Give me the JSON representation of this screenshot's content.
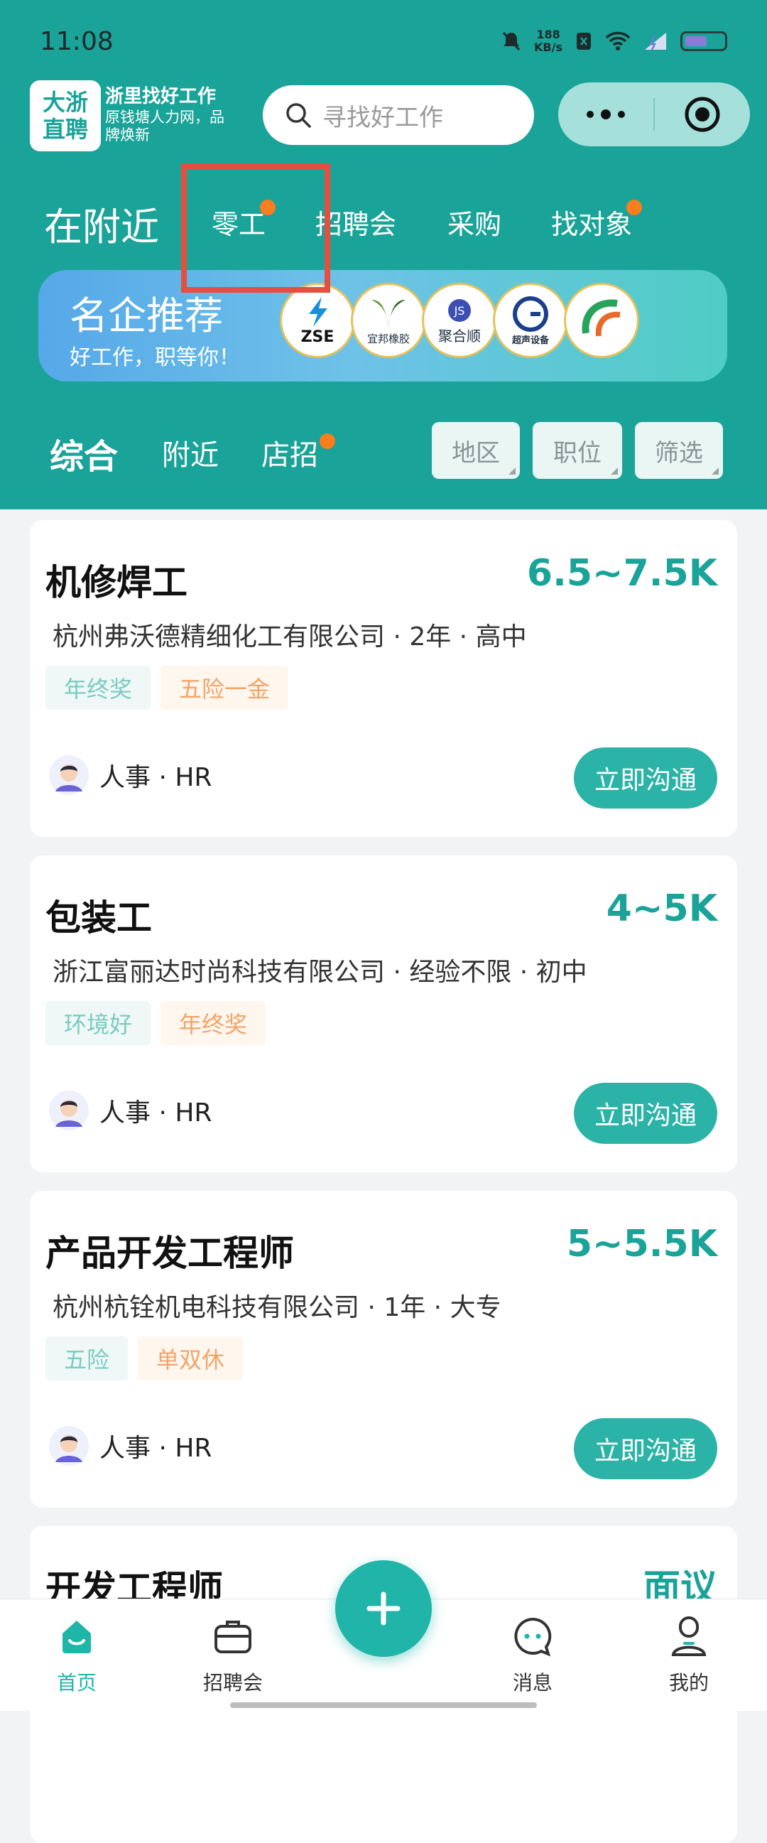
{
  "status": {
    "time": "11:08",
    "speed_value": "188",
    "speed_unit": "KB/s"
  },
  "header": {
    "logo_line1": "大浙",
    "logo_line2": "直聘",
    "logo_title": "浙里找好工作",
    "logo_sub": "原钱塘人力网，品牌焕新",
    "search_placeholder": "寻找好工作"
  },
  "nav": {
    "near": "在附近",
    "items": [
      {
        "label": "零工",
        "dot": true
      },
      {
        "label": "招聘会",
        "dot": false
      },
      {
        "label": "采购",
        "dot": false
      },
      {
        "label": "找对象",
        "dot": true
      }
    ]
  },
  "banner": {
    "title": "名企推荐",
    "subtitle": "好工作，职等你！",
    "brands": [
      "ZSE",
      "宜邦橡胶",
      "聚合顺",
      "超声设备",
      ""
    ]
  },
  "tabs": {
    "active": "综合",
    "near": "附近",
    "shop": "店招",
    "filters": [
      "地区",
      "职位",
      "筛选"
    ]
  },
  "jobs": [
    {
      "title": "机修焊工",
      "salary": "6.5~7.5K",
      "company": "杭州弗沃德精细化工有限公司 · 2年 · 高中",
      "tags": [
        "年终奖",
        "五险一金"
      ],
      "hr": "人事 · HR",
      "action": "立即沟通"
    },
    {
      "title": "包装工",
      "salary": "4~5K",
      "company": "浙江富丽达时尚科技有限公司 · 经验不限 · 初中",
      "tags": [
        "环境好",
        "年终奖"
      ],
      "hr": "人事 · HR",
      "action": "立即沟通"
    },
    {
      "title": "产品开发工程师",
      "salary": "5~5.5K",
      "company": "杭州杭铨机电科技有限公司 · 1年 · 大专",
      "tags": [
        "五险",
        "单双休"
      ],
      "hr": "人事 · HR",
      "action": "立即沟通"
    },
    {
      "title": "开发工程师",
      "salary": "面议"
    }
  ],
  "bottom_nav": {
    "home": "首页",
    "fairs": "招聘会",
    "messages": "消息",
    "mine": "我的"
  },
  "colors": {
    "primary": "#1aa399",
    "accent_dot": "#fa7d1e",
    "highlight_box": "#e4503f"
  }
}
